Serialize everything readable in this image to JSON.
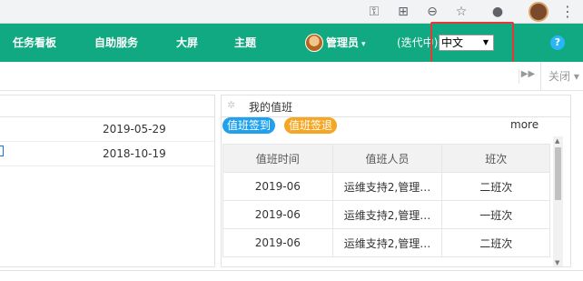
{
  "browser": {
    "icons": [
      "key-icon",
      "translate-icon",
      "zoom-icon",
      "star-icon",
      "extension-icon",
      "profile-avatar",
      "more-icon"
    ]
  },
  "header": {
    "nav": [
      "任务看板",
      "自助服务",
      "大屏",
      "主题"
    ],
    "user_name": "管理员",
    "iteration_label": "(迭代中)",
    "language": {
      "selected": "中文"
    },
    "help_label": "?",
    "bg_color": "#11a981"
  },
  "tabbar": {
    "close_label": "关闭"
  },
  "left_panel": {
    "rows": [
      {
        "date": "2019-05-29"
      },
      {
        "date": "2018-10-19"
      }
    ]
  },
  "duty_panel": {
    "title": "我的值班",
    "check_in_label": "值班签到",
    "check_out_label": "值班签退",
    "more_label": "more",
    "columns": [
      "值班时间",
      "值班人员",
      "班次"
    ],
    "rows": [
      {
        "time": "2019-06",
        "people": "运维支持2,管理…",
        "shift": "二班次"
      },
      {
        "time": "2019-06",
        "people": "运维支持2,管理…",
        "shift": "一班次"
      },
      {
        "time": "2019-06",
        "people": "运维支持2,管理…",
        "shift": "二班次"
      }
    ]
  }
}
